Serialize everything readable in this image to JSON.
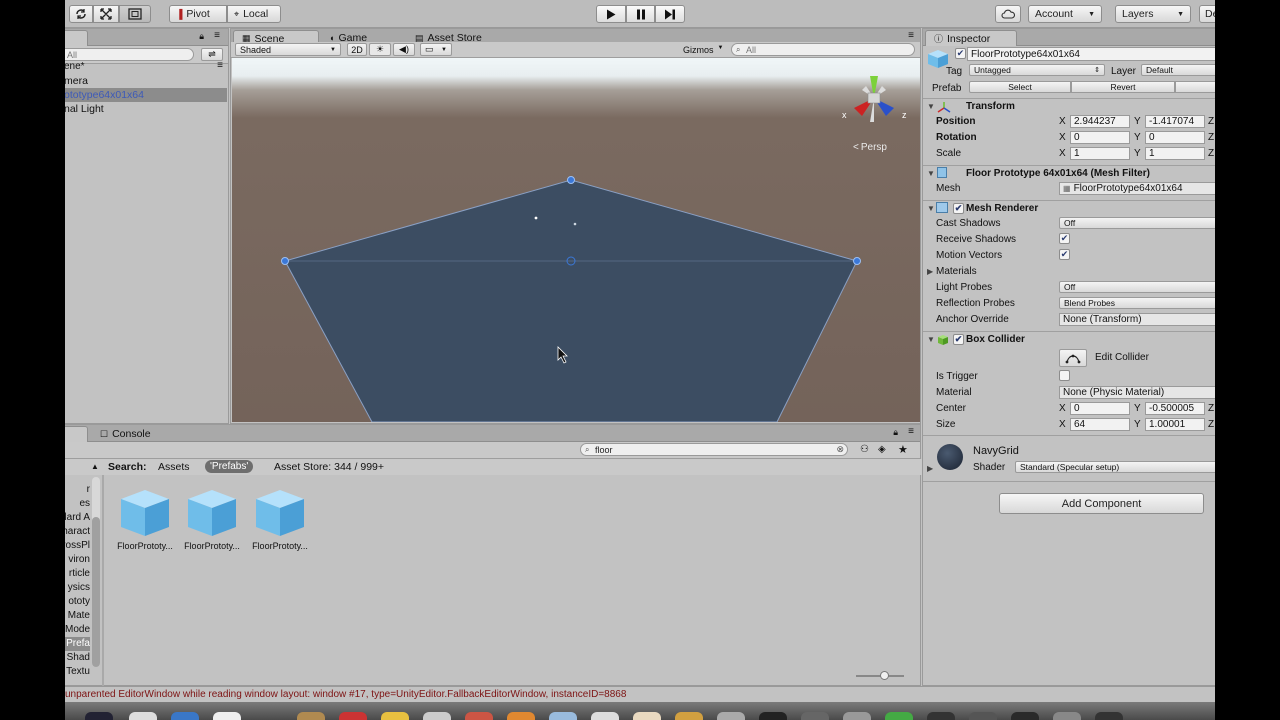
{
  "toolbar": {
    "pivot": "Pivot",
    "local": "Local",
    "account": "Account",
    "layers": "Layers",
    "layout_partial": "De"
  },
  "hierarchy": {
    "search_placeholder": "All",
    "scene_name": "ene*",
    "items": [
      "mera",
      "ototype64x01x64",
      "nal Light"
    ],
    "selected_index": 1
  },
  "scene_tabs": {
    "scene": "Scene",
    "game": "Game",
    "asset_store": "Asset Store"
  },
  "scene_bar": {
    "shading": "Shaded",
    "mode_2d": "2D",
    "gizmos": "Gizmos",
    "search_placeholder": "All",
    "gizmo_x": "x",
    "gizmo_z": "z",
    "persp": "Persp"
  },
  "project": {
    "tab_console": "Console",
    "search_value": "floor",
    "search_label": "Search:",
    "filter_assets": "Assets",
    "filter_prefabs": "'Prefabs'",
    "asset_store_count": "Asset Store: 344 / 999+",
    "left_items": [
      "r",
      "es",
      "lard A",
      "haract",
      "rossPl",
      "viron",
      "rticle",
      "ysics",
      "ototy",
      "Mate",
      "Mode",
      "Prefa",
      "Shad",
      "Textu"
    ],
    "left_selected_index": 11,
    "assets": [
      "FloorPrototy...",
      "FloorPrototy...",
      "FloorPrototy..."
    ]
  },
  "inspector": {
    "tab": "Inspector",
    "object_name": "FloorPrototype64x01x64",
    "tag_label": "Tag",
    "tag_value": "Untagged",
    "layer_label": "Layer",
    "layer_value": "Default",
    "prefab_label": "Prefab",
    "prefab_select": "Select",
    "prefab_revert": "Revert",
    "transform": {
      "title": "Transform",
      "position_label": "Position",
      "rotation_label": "Rotation",
      "scale_label": "Scale",
      "position": {
        "x": "2.944237",
        "y": "-1.417074"
      },
      "rotation": {
        "x": "0",
        "y": "0"
      },
      "scale": {
        "x": "1",
        "y": "1"
      }
    },
    "axis": {
      "x": "X",
      "y": "Y",
      "z": "Z"
    },
    "mesh_filter": {
      "title": "Floor Prototype 64x01x64 (Mesh Filter)",
      "mesh_label": "Mesh",
      "mesh_value": "FloorPrototype64x01x64"
    },
    "mesh_renderer": {
      "title": "Mesh Renderer",
      "cast_shadows_label": "Cast Shadows",
      "cast_shadows_value": "Off",
      "receive_shadows_label": "Receive Shadows",
      "motion_vectors_label": "Motion Vectors",
      "materials_label": "Materials",
      "light_probes_label": "Light Probes",
      "light_probes_value": "Off",
      "reflection_probes_label": "Reflection Probes",
      "reflection_probes_value": "Blend Probes",
      "anchor_override_label": "Anchor Override",
      "anchor_override_value": "None (Transform)"
    },
    "box_collider": {
      "title": "Box Collider",
      "edit_collider": "Edit Collider",
      "is_trigger_label": "Is Trigger",
      "material_label": "Material",
      "material_value": "None (Physic Material)",
      "center_label": "Center",
      "center": {
        "x": "0",
        "y": "-0.500005"
      },
      "size_label": "Size",
      "size": {
        "x": "64",
        "y": "1.00001"
      }
    },
    "material": {
      "name": "NavyGrid",
      "shader_label": "Shader",
      "shader_value": "Standard (Specular setup)"
    },
    "add_component": "Add Component"
  },
  "status_message": "unparented EditorWindow while reading window layout: window #17, type=UnityEditor.FallbackEditorWindow, instanceID=8868",
  "colors": {
    "editor_bg": "#c2c2c2",
    "floor_plane": "#3c4d62",
    "selection_text": "#3d5ab9",
    "status_error": "#7d1313"
  }
}
